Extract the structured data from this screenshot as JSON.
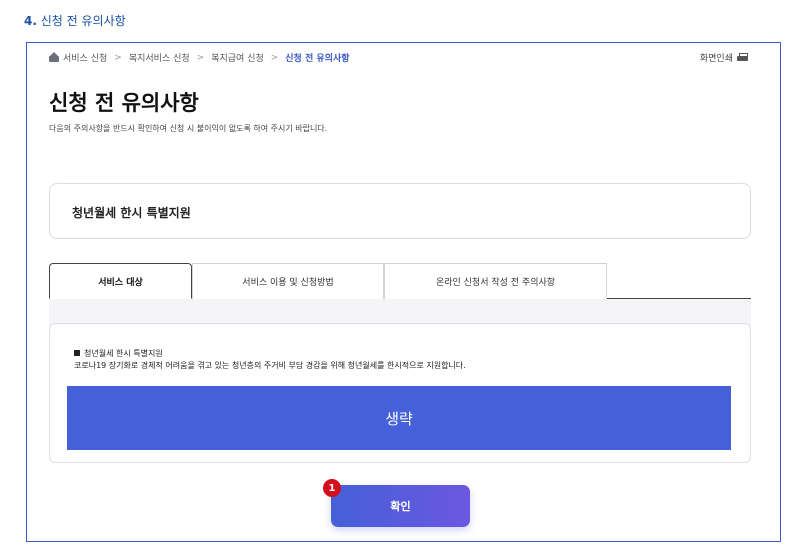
{
  "step": {
    "number": "4.",
    "title": "신청 전 유의사항"
  },
  "breadcrumb": {
    "items": [
      "서비스 신청",
      "복지서비스 신청",
      "복지급여 신청",
      "신청 전 유의사항"
    ],
    "separator": ">"
  },
  "print_label": "화면인쇄",
  "page": {
    "title": "신청 전 유의사항",
    "description": "다음의 주의사항을 반드시 확인하여 신청 시 불이익이 없도록 하여 주시기 바랍니다."
  },
  "service": {
    "name": "청년월세 한시 특별지원"
  },
  "tabs": [
    {
      "label": "서비스 대상",
      "active": true
    },
    {
      "label": "서비스 이용 및 신청방법",
      "active": false
    },
    {
      "label": "온라인 신청서 작성 전 주의사항",
      "active": false
    }
  ],
  "content": {
    "heading": "청년월세 한시 특별지원",
    "text": "코로나19 장기화로 경제적 어려움을 겪고 있는 청년층의 주거비 부담 경감을 위해 청년월세를 한시적으로 지원합니다.",
    "omitted_label": "생략"
  },
  "confirm_button": {
    "label": "확인"
  },
  "marker": {
    "label": "1"
  },
  "colors": {
    "accent": "#4560d8",
    "frame": "#3b57c4",
    "marker": "#d40f1c",
    "step_title": "#1a4fa3"
  }
}
